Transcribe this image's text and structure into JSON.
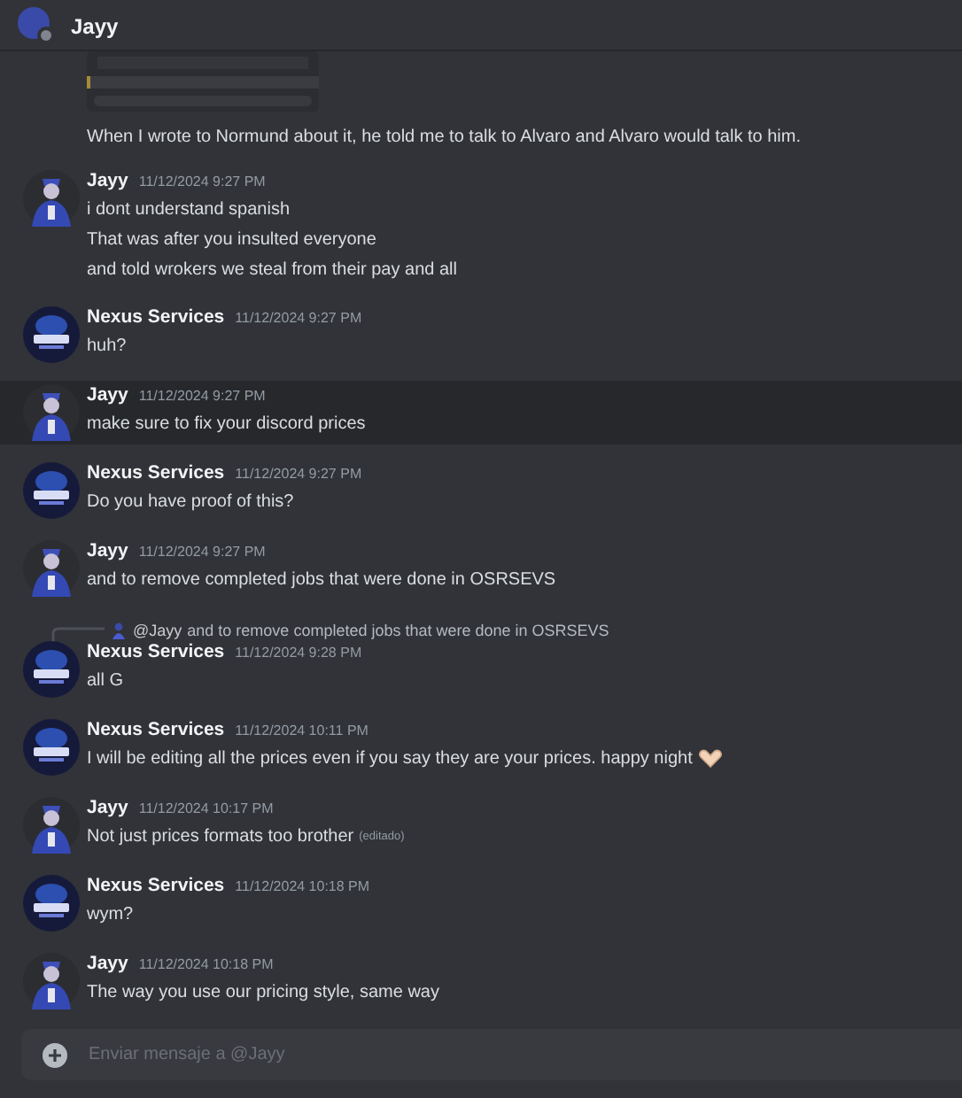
{
  "header": {
    "title": "Jayy",
    "online": false
  },
  "messages": [
    {
      "kind": "continuation",
      "attachment": true,
      "lines": [
        "When I wrote to Normund about it, he told me to talk to Alvaro and Alvaro would talk to him."
      ],
      "hovered": false
    },
    {
      "kind": "group",
      "avatar": {
        "kind": "wizard"
      },
      "author": "Jayy",
      "time": "11/12/2024 9:27 PM",
      "lines": [
        "i dont understand spanish",
        "That was after you insulted everyone",
        "and told wrokers we steal from their pay and all"
      ],
      "hovered": false
    },
    {
      "kind": "group",
      "avatar": {
        "kind": "logo"
      },
      "author": "Nexus Services",
      "time": "11/12/2024 9:27 PM",
      "lines": [
        "huh?"
      ],
      "hovered": false
    },
    {
      "kind": "group",
      "avatar": {
        "kind": "wizard"
      },
      "author": "Jayy",
      "time": "11/12/2024 9:27 PM",
      "lines": [
        "make sure to fix your discord prices"
      ],
      "hovered": true
    },
    {
      "kind": "group",
      "avatar": {
        "kind": "logo"
      },
      "author": "Nexus Services",
      "time": "11/12/2024 9:27 PM",
      "lines": [
        "Do you have proof of this?"
      ],
      "hovered": false
    },
    {
      "kind": "group",
      "avatar": {
        "kind": "wizard"
      },
      "author": "Jayy",
      "time": "11/12/2024 9:27 PM",
      "lines": [
        "and to remove completed jobs that were done in OSRSEVS"
      ],
      "hovered": false
    },
    {
      "kind": "group",
      "avatar": {
        "kind": "logo"
      },
      "author": "Nexus Services",
      "time": "11/12/2024 9:28 PM",
      "reply": {
        "mention": "@Jayy",
        "text": "and to remove completed jobs that were done in OSRSEVS"
      },
      "lines": [
        "all G"
      ],
      "hovered": false
    },
    {
      "kind": "group",
      "avatar": {
        "kind": "logo"
      },
      "author": "Nexus Services",
      "time": "11/12/2024 10:11 PM",
      "lines": [
        "I will be editing all the prices even if you say they are your prices. happy night"
      ],
      "heart_hands_emoji": true,
      "hovered": false
    },
    {
      "kind": "group",
      "avatar": {
        "kind": "wizard"
      },
      "author": "Jayy",
      "time": "11/12/2024 10:17 PM",
      "lines": [
        "Not just prices formats too brother"
      ],
      "edited_label": "(editado)",
      "hovered": false
    },
    {
      "kind": "group",
      "avatar": {
        "kind": "logo"
      },
      "author": "Nexus Services",
      "time": "11/12/2024 10:18 PM",
      "lines": [
        "wym?"
      ],
      "hovered": false
    },
    {
      "kind": "group",
      "avatar": {
        "kind": "wizard"
      },
      "author": "Jayy",
      "time": "11/12/2024 10:18 PM",
      "lines": [
        "The way you use our pricing style, same way"
      ],
      "hovered": false
    }
  ],
  "composer": {
    "placeholder": "Enviar mensaje a @Jayy"
  }
}
